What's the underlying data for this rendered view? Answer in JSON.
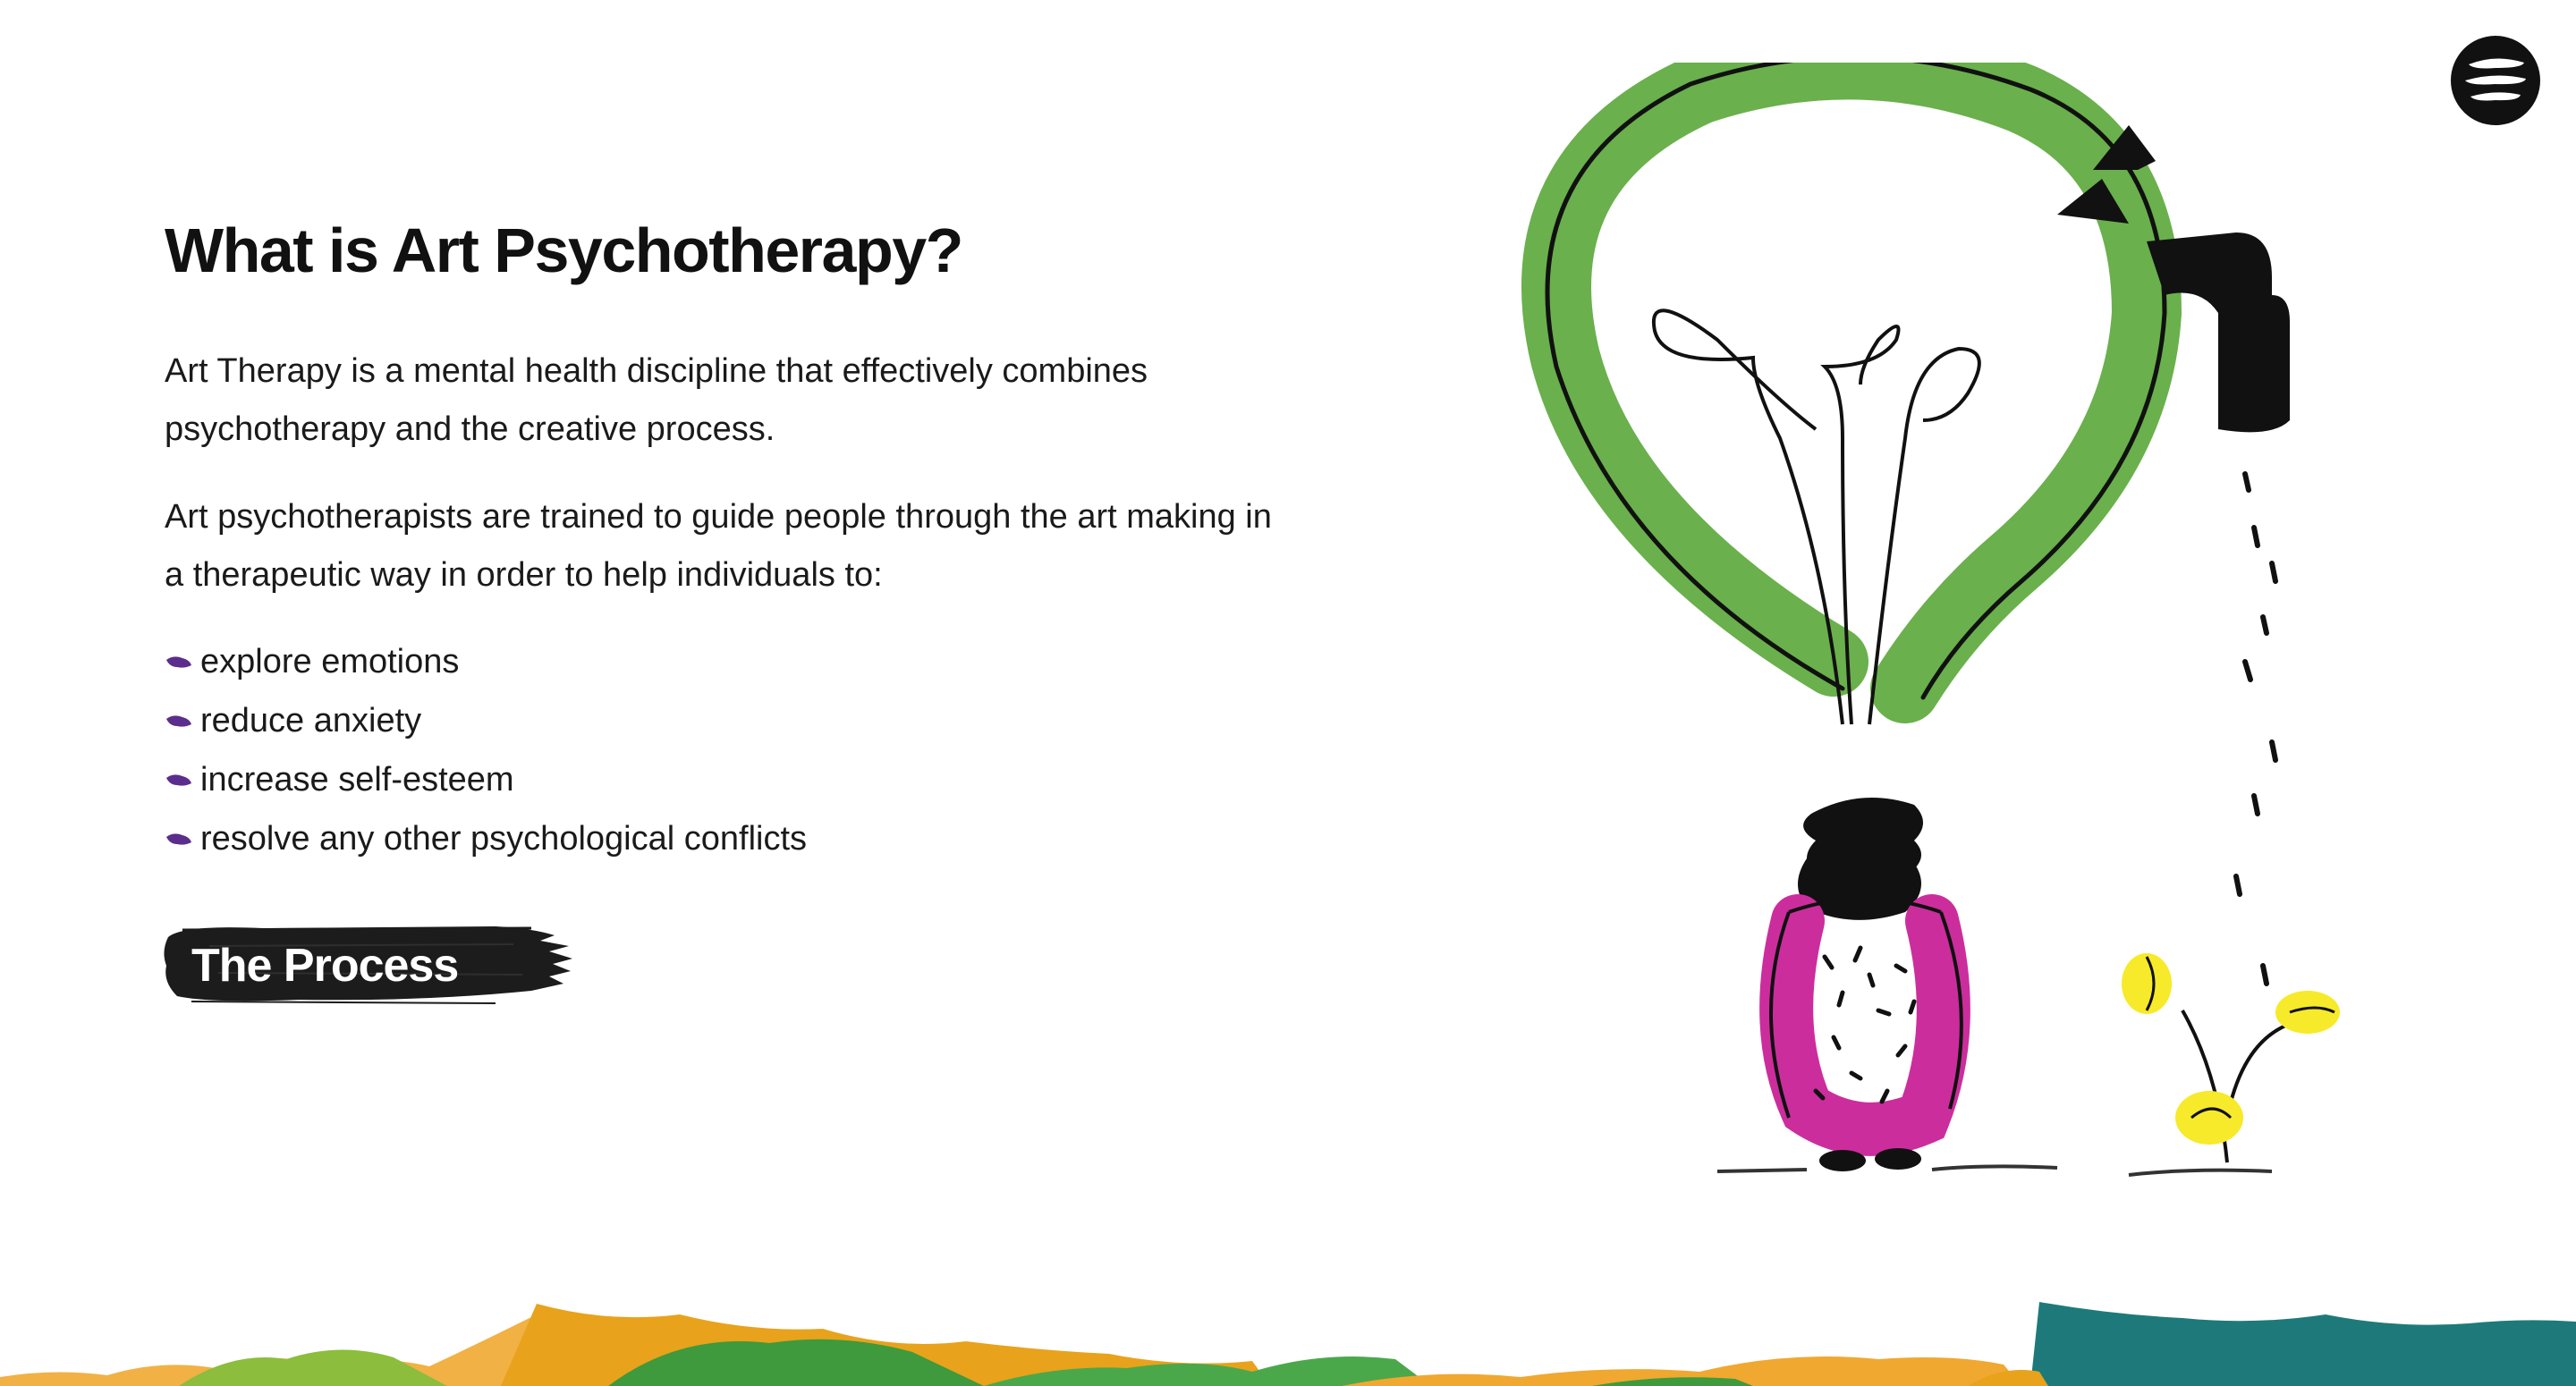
{
  "header": {
    "menu_icon": "hamburger-menu-icon"
  },
  "main": {
    "title": "What is Art Psychotherapy?",
    "paragraphs": [
      "Art Therapy is a mental health discipline that effectively combines psychotherapy and the creative process.",
      "Art psychotherapists are trained to guide people through the art making in a therapeutic way in order to help individuals to:"
    ],
    "benefits": [
      "explore emotions",
      "reduce anxiety",
      "increase self-esteem",
      "resolve any other psychological conflicts"
    ],
    "process_button": "The Process"
  },
  "illustration": {
    "subject": "lightbulb-person-watering-plant",
    "colors": {
      "bulb": "#6ab04c",
      "coat": "#cc2d9c",
      "leaves": "#f7ea2a",
      "ink": "#111111"
    }
  },
  "colors": {
    "bullet": "#5b2d8c",
    "button_bg": "#1c1c1c",
    "text": "#1a1a1a"
  }
}
